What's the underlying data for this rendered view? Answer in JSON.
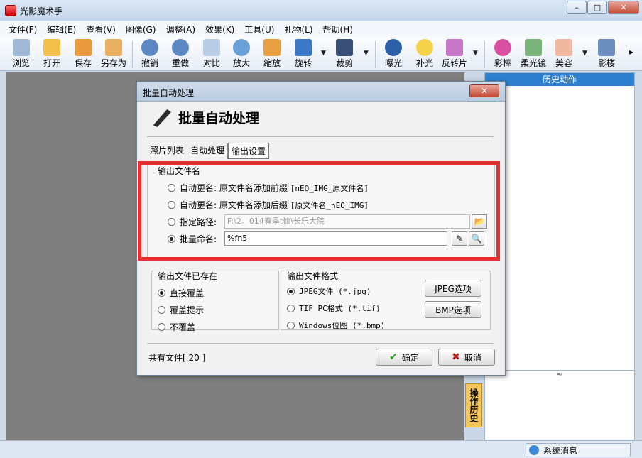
{
  "app": {
    "title": "光影魔术手"
  },
  "window_buttons": {
    "minimize": "–",
    "maximize": "□",
    "close": "✕"
  },
  "menu": [
    "文件(F)",
    "编辑(E)",
    "查看(V)",
    "图像(G)",
    "调整(A)",
    "效果(K)",
    "工具(U)",
    "礼物(L)",
    "帮助(H)"
  ],
  "toolbar": {
    "browse": "浏览",
    "open": "打开",
    "save": "保存",
    "save_as": "另存为",
    "undo": "撤销",
    "redo": "重做",
    "compare": "对比",
    "zoom_in": "放大",
    "zoom_fit": "缩放",
    "rotate": "旋转",
    "crop": "裁剪",
    "exposure": "曝光",
    "fill_light": "补光",
    "reversal": "反转片",
    "color_stick": "彩棒",
    "soft_focus": "柔光镜",
    "beauty": "美容",
    "studio": "影楼",
    "more": "▸"
  },
  "right_panel": {
    "title": "历史动作",
    "collapse": "≈"
  },
  "side_tab": "操作历史",
  "status": {
    "label": "系统消息"
  },
  "dialog": {
    "title": "批量自动处理",
    "close": "✕",
    "heading": "批量自动处理",
    "tabs": [
      "照片列表",
      "自动处理",
      "输出设置"
    ],
    "output_name": {
      "title": "输出文件名",
      "opt_prefix_label": "自动更名:",
      "opt_prefix_text": "原文件名添加前缀",
      "opt_prefix_code": "[nEO_IMG_原文件名]",
      "opt_suffix_label": "自动更名:",
      "opt_suffix_text": "原文件名添加后缀",
      "opt_suffix_code": "[原文件名_nEO_IMG]",
      "opt_path_label": "指定路径:",
      "path_value": "F:\\2。014春季t恤\\长乐大院",
      "opt_batch_label": "批量命名:",
      "batch_value": "%fn5"
    },
    "existing": {
      "title": "输出文件已存在",
      "overwrite": "直接覆盖",
      "prompt": "覆盖提示",
      "skip": "不覆盖"
    },
    "format": {
      "title": "输出文件格式",
      "jpeg": "JPEG文件 (*.jpg)",
      "tif": "TIF PC格式 (*.tif)",
      "bmp": "Windows位图 (*.bmp)",
      "jpeg_opts": "JPEG选项",
      "bmp_opts": "BMP选项"
    },
    "count": "共有文件[ 20 ]",
    "ok": "确定",
    "cancel": "取消"
  }
}
